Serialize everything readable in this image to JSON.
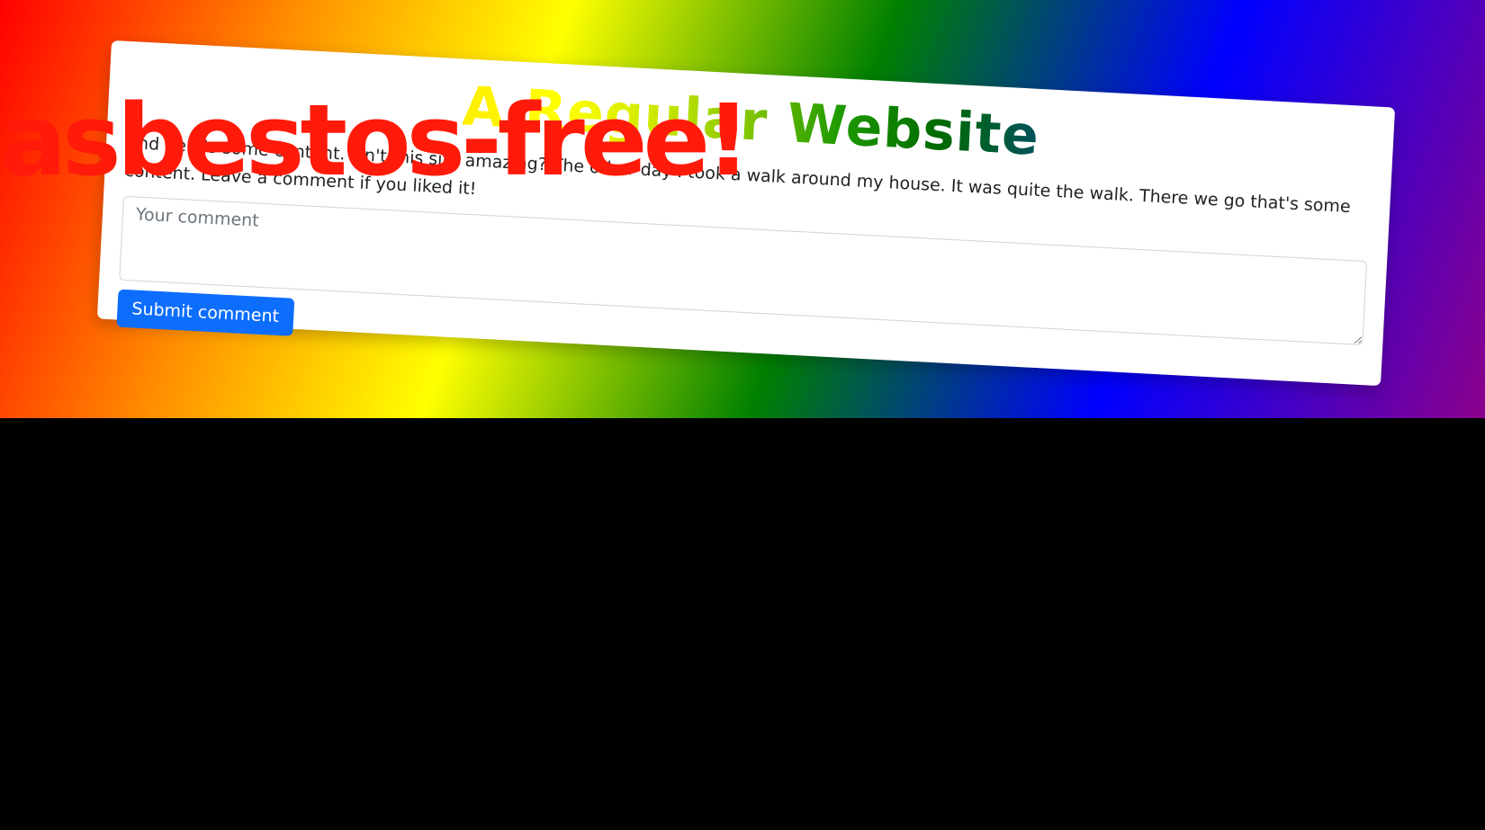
{
  "page": {
    "title": "A Regular Website",
    "content": "And here's some content. Isn't this site amazing? The other day I took a walk around my house. It was quite the walk. There we go that's some content. Leave a comment if you liked it!",
    "overlay": "asbestos-free!"
  },
  "form": {
    "comment_placeholder": "Your comment",
    "submit_label": "Submit comment"
  },
  "colors": {
    "button": "#0d6efd",
    "overlay_text": "#ff1a0a"
  }
}
